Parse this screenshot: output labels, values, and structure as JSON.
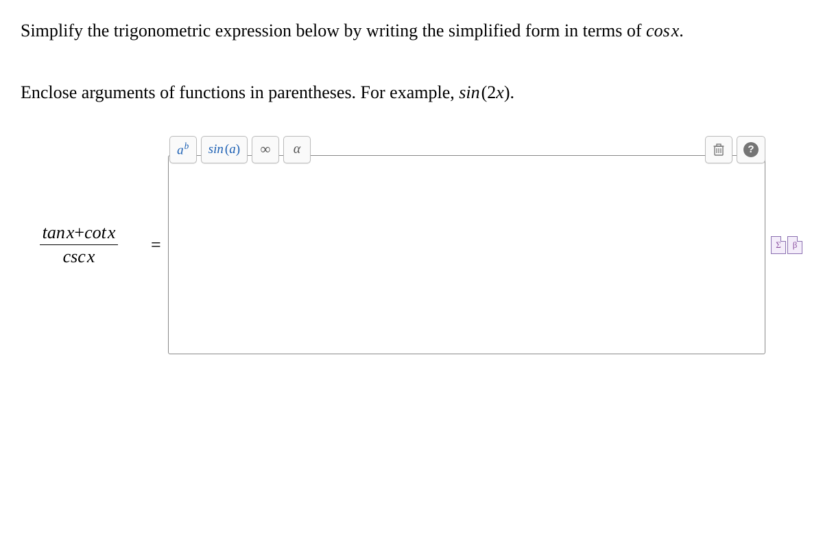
{
  "prompt": {
    "line1_pre": "Simplify the trigonometric expression below by writing the simplified form in terms of ",
    "line1_func": "cos",
    "line1_var": "x",
    "line1_post": ".",
    "line2_pre": "Enclose arguments of functions in parentheses. For example, ",
    "line2_func": "sin",
    "line2_arg_open": "(",
    "line2_arg_num": "2",
    "line2_arg_var": "x",
    "line2_arg_close": ")",
    "line2_post": "."
  },
  "expression": {
    "num_t1_func": "tan",
    "num_t1_var": "x",
    "num_plus": "+",
    "num_t2_func": "cot",
    "num_t2_var": "x",
    "den_func": "csc",
    "den_var": "x",
    "equals": "="
  },
  "toolbar": {
    "exp_a": "a",
    "exp_b": "b",
    "trig_label": "sin",
    "trig_arg_open": "(",
    "trig_arg_a": "a",
    "trig_arg_close": ")",
    "infinity": "∞",
    "alpha": "α",
    "help": "?"
  },
  "side": {
    "sigma": "Σ",
    "beta": "β"
  }
}
